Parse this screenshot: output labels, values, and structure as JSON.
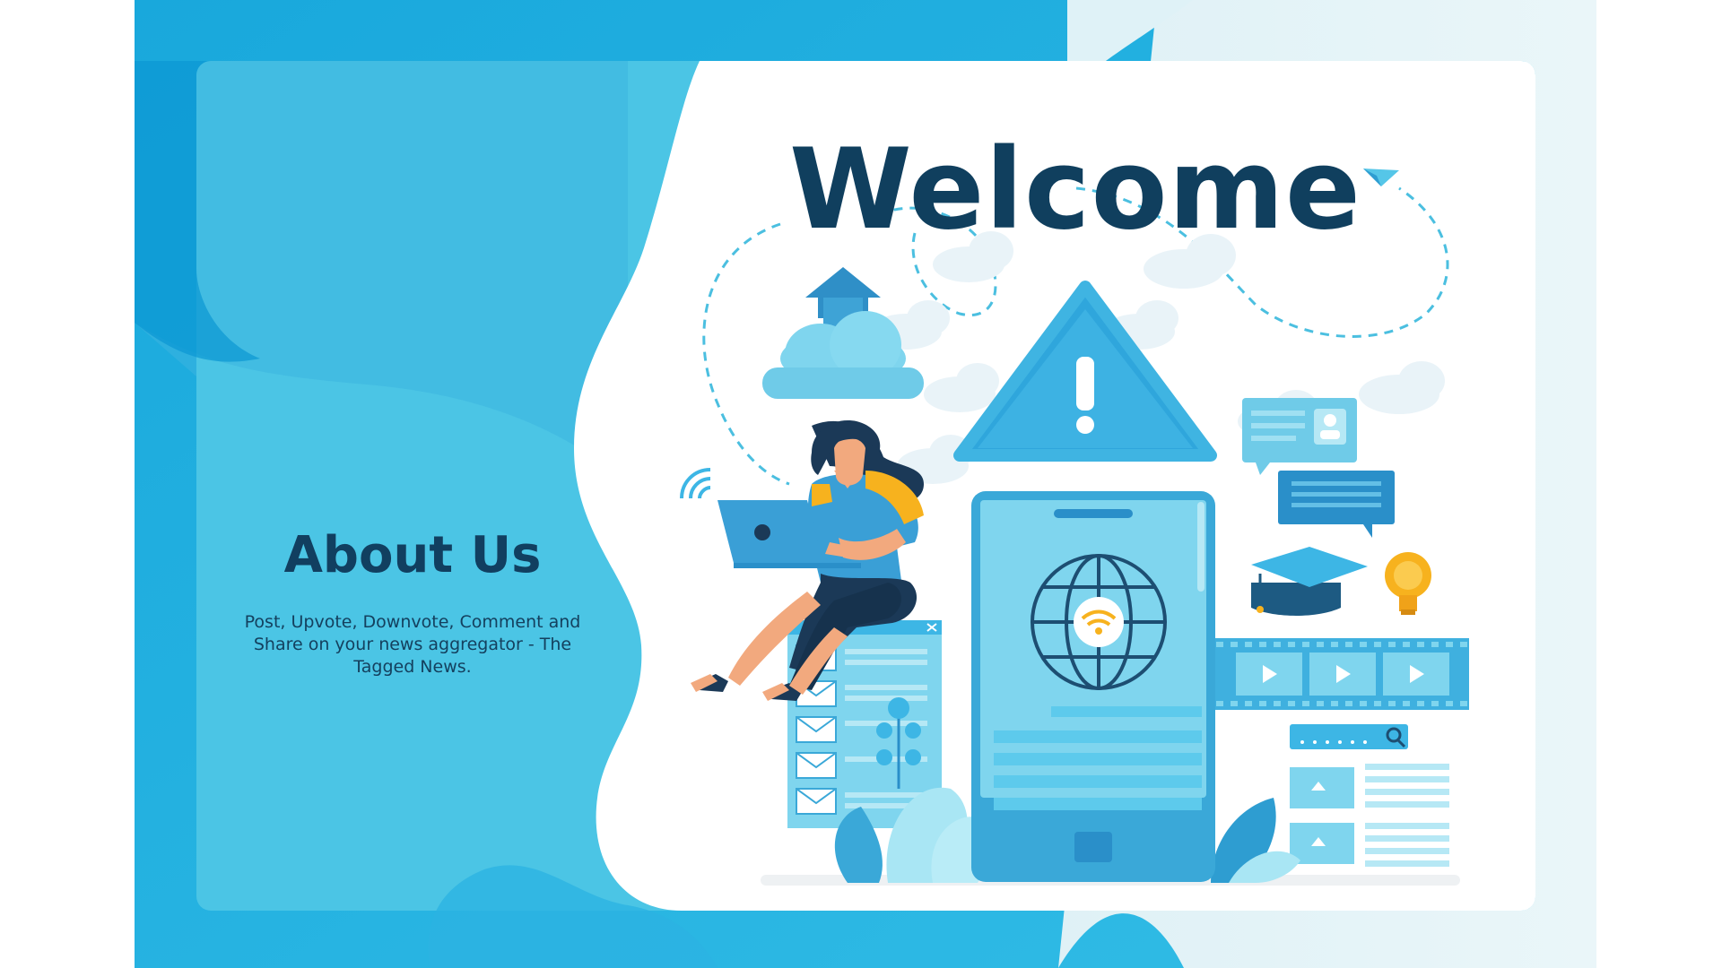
{
  "hero": {
    "title": "Welcome"
  },
  "about": {
    "title": "About Us",
    "description": "Post, Upvote, Downvote, Comment and Share on your news aggregator - The Tagged News."
  },
  "colors": {
    "frame_blue": "#1fb3e0",
    "panel_blue": "#4bc5e5",
    "card_white": "#ffffff",
    "heading_navy": "#103f5e",
    "accent_yellow": "#f7b21e",
    "skin": "#f2a97e",
    "shirt": "#3a9fd6"
  },
  "illustration": {
    "icons": [
      "cloud-upload-icon",
      "warning-triangle-icon",
      "smartphone-icon",
      "globe-wifi-icon",
      "laptop-icon",
      "email-list-icon",
      "chat-bubble-icon",
      "profile-card-icon",
      "graduation-cap-icon",
      "lightbulb-icon",
      "video-filmstrip-icon",
      "search-bar-icon",
      "paper-plane-icon"
    ]
  }
}
